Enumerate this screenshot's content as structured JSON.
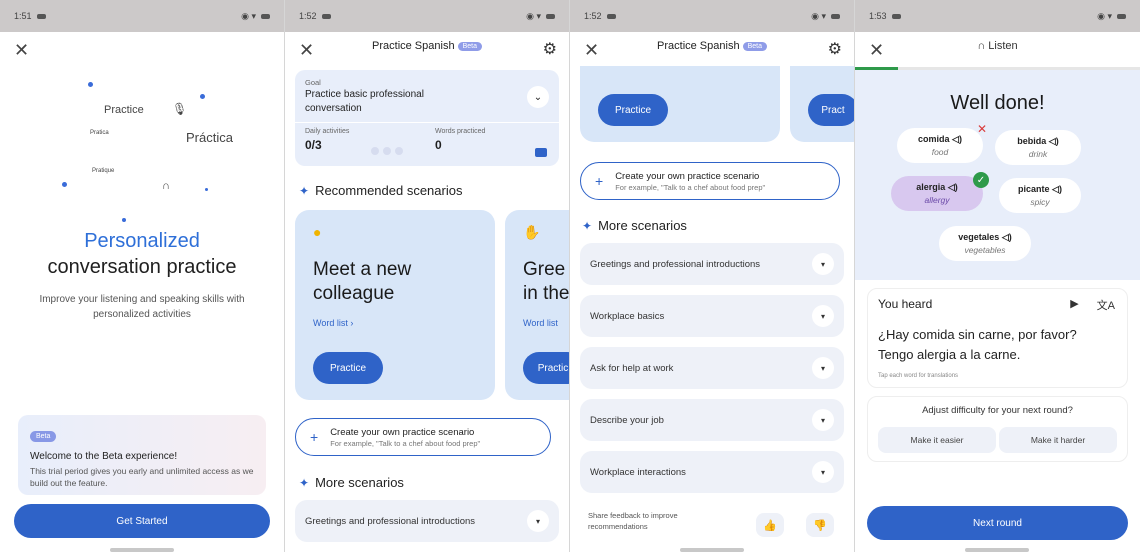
{
  "colors": {
    "primary": "#2f63c8",
    "accent_blue": "#2e6fd8",
    "card_blue": "#d8e6f8",
    "success": "#2e9a4a",
    "error": "#d93c3c"
  },
  "screen1": {
    "status_time": "1:51",
    "cloud": {
      "practice_en": "Practice",
      "practica_es": "Práctica",
      "pratica": "Pratica",
      "pratique": "Pratique"
    },
    "title_line1": "Personalized",
    "title_line2": "conversation practice",
    "subtitle": "Improve your listening and speaking skills with personalized activities",
    "beta_badge": "Beta",
    "beta_title": "Welcome to the Beta experience!",
    "beta_body": "This trial period gives you early and unlimited access as we build out the feature.",
    "cta": "Get Started"
  },
  "screen2": {
    "status_time": "1:52",
    "title": "Practice Spanish",
    "beta": "Beta",
    "goal_label": "Goal",
    "goal_text": "Practice basic professional conversation",
    "daily_label": "Daily activities",
    "daily_value": "0/3",
    "words_label": "Words practiced",
    "words_value": "0",
    "recommended": "Recommended scenarios",
    "card1": {
      "title": "Meet a new colleague",
      "word_list": "Word list  ›",
      "practice": "Practice"
    },
    "card2": {
      "title": "Gree in the",
      "word_list": "Word list",
      "practice": "Practic"
    },
    "create_title": "Create your own practice scenario",
    "create_example": "For example, \"Talk to a chef about food prep\"",
    "more": "More scenarios",
    "row1": "Greetings and professional introductions"
  },
  "screen3": {
    "status_time": "1:52",
    "title": "Practice Spanish",
    "beta": "Beta",
    "practice": "Practice",
    "practice_cut": "Pract",
    "create_title": "Create your own practice scenario",
    "create_example": "For example, \"Talk to a chef about food prep\"",
    "more": "More scenarios",
    "rows": [
      "Greetings and professional introductions",
      "Workplace basics",
      "Ask for help at work",
      "Describe your job",
      "Workplace interactions"
    ],
    "feedback": "Share feedback to improve recommendations"
  },
  "screen4": {
    "status_time": "1:53",
    "listen": "Listen",
    "progress": 0.15,
    "well_done": "Well done!",
    "words": [
      {
        "es": "comida",
        "en": "food"
      },
      {
        "es": "bebida",
        "en": "drink"
      },
      {
        "es": "alergia",
        "en": "allergy"
      },
      {
        "es": "picante",
        "en": "spicy"
      },
      {
        "es": "vegetales",
        "en": "vegetables"
      }
    ],
    "you_heard": "You heard",
    "sentence_line1": "¿Hay comida sin carne, por favor?",
    "sentence_line2": "Tengo alergia a la carne.",
    "hint": "Tap each word for translations",
    "difficulty_q": "Adjust difficulty for your next round?",
    "easier": "Make it easier",
    "harder": "Make it harder",
    "next": "Next round"
  }
}
